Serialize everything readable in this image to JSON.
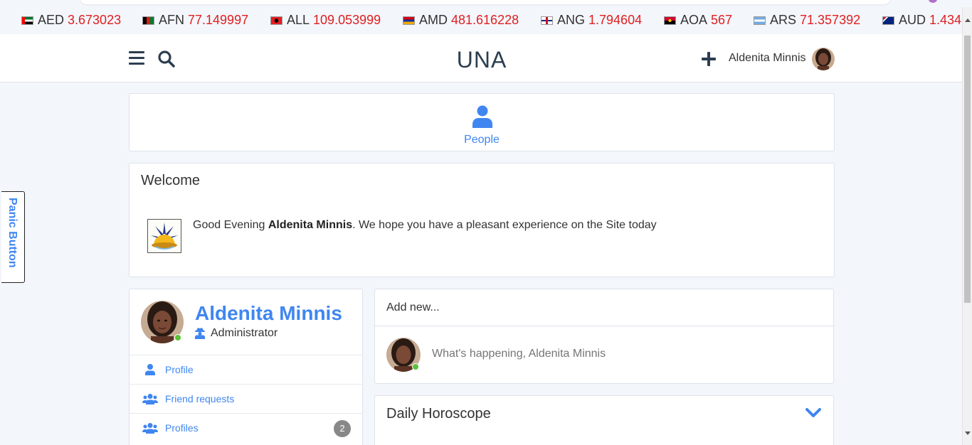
{
  "ticker": [
    {
      "code": "AED",
      "rate": "3.673023",
      "flag": [
        "#00732f",
        "#ffffff",
        "#000000",
        "#ff0000"
      ]
    },
    {
      "code": "AFN",
      "rate": "77.149997",
      "flag": [
        "#000000",
        "#d32011",
        "#007a36"
      ]
    },
    {
      "code": "ALL",
      "rate": "109.053999",
      "flag": [
        "#e41e20",
        "#000000"
      ]
    },
    {
      "code": "AMD",
      "rate": "481.616228",
      "flag": [
        "#d90012",
        "#0033a0",
        "#f2a800"
      ]
    },
    {
      "code": "ANG",
      "rate": "1.794604",
      "flag": [
        "#ffffff",
        "#012a87",
        "#ce1126"
      ]
    },
    {
      "code": "AOA",
      "rate": "567",
      "flag": [
        "#cc092f",
        "#000000",
        "#ffcb00"
      ]
    },
    {
      "code": "ARS",
      "rate": "71.357392",
      "flag": [
        "#74acdf",
        "#ffffff",
        "#74acdf"
      ]
    },
    {
      "code": "AUD",
      "rate": "1.434",
      "flag": [
        "#00247d",
        "#ffffff",
        "#cf142b"
      ]
    }
  ],
  "header": {
    "site_title": "UNA",
    "user_name": "Aldenita Minnis"
  },
  "people": {
    "label": "People"
  },
  "welcome": {
    "title": "Welcome",
    "greeting_prefix": "Good Evening ",
    "greeting_name": "Aldenita Minnis",
    "greeting_suffix": ". We hope you have a pleasant experience on the Site today"
  },
  "profile": {
    "name": "Aldenita Minnis",
    "role": "Administrator",
    "menu": [
      {
        "label": "Profile",
        "icon": "user-icon"
      },
      {
        "label": "Friend requests",
        "icon": "users-icon"
      },
      {
        "label": "Profiles",
        "icon": "users-icon",
        "badge": "2"
      }
    ]
  },
  "add_new": {
    "title": "Add new...",
    "placeholder": "What's happening, Aldenita Minnis"
  },
  "horoscope": {
    "title": "Daily Horoscope"
  },
  "panic": {
    "label": "Panic Button"
  },
  "colors": {
    "accent": "#3f86f0",
    "rate": "#e02020",
    "online": "#5bc236"
  }
}
